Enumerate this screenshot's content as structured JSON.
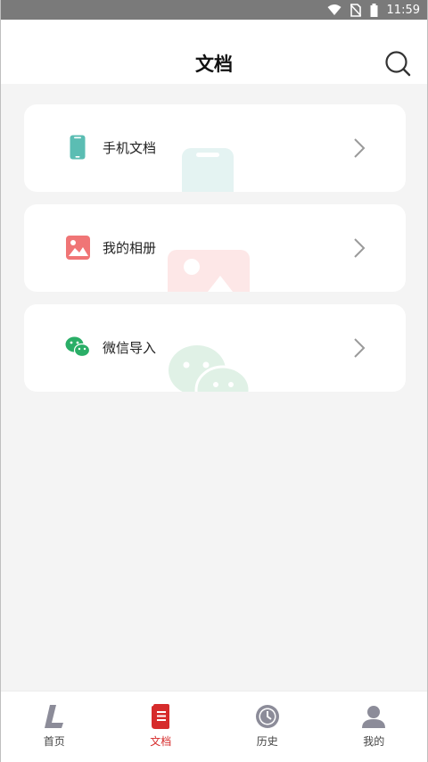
{
  "status_bar": {
    "time": "11:59"
  },
  "header": {
    "title": "文档"
  },
  "cards": [
    {
      "label": "手机文档",
      "icon": "phone-icon",
      "color": "#5bbdb3"
    },
    {
      "label": "我的相册",
      "icon": "photo-album-icon",
      "color": "#f07576"
    },
    {
      "label": "微信导入",
      "icon": "wechat-icon",
      "color": "#2aae67"
    }
  ],
  "tabbar": {
    "items": [
      {
        "label": "首页",
        "icon": "home-l-icon",
        "active": false
      },
      {
        "label": "文档",
        "icon": "document-icon",
        "active": true
      },
      {
        "label": "历史",
        "icon": "clock-icon",
        "active": false
      },
      {
        "label": "我的",
        "icon": "user-icon",
        "active": false
      }
    ],
    "active_color": "#d62b2b"
  }
}
